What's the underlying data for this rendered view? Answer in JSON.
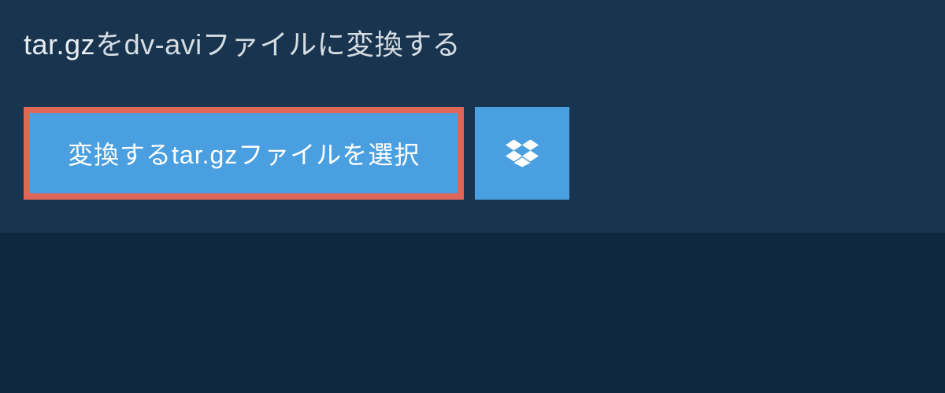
{
  "title": {
    "source_format": "tar.gz",
    "middle_text": "を",
    "target_format": "dv-avi",
    "suffix_text": "ファイルに変換する"
  },
  "buttons": {
    "select_prefix": "変換する",
    "select_format": "tar.gz",
    "select_suffix": "ファイルを選択"
  }
}
